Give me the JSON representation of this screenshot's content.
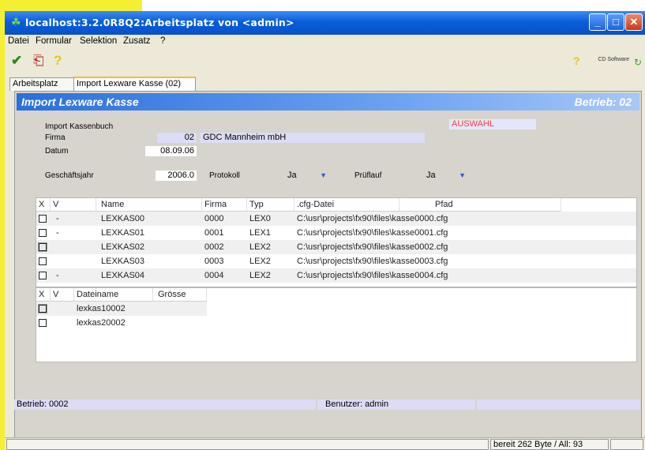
{
  "window": {
    "title": "localhost:3.2.0R8Q2:Arbeitsplatz von <admin>",
    "controls": [
      "minimize",
      "maximize",
      "close"
    ]
  },
  "menu": {
    "items": [
      "Datei",
      "Formular",
      "Selektion",
      "Zusatz",
      "?"
    ]
  },
  "toolbar": {
    "icons": [
      "check-icon",
      "exit-door-icon",
      "help-icon"
    ],
    "brand": "CD Software"
  },
  "tabs": [
    {
      "label": "Arbeitsplatz"
    },
    {
      "label": "Import Lexware Kasse (02)"
    }
  ],
  "form": {
    "header_title": "Import Lexware Kasse",
    "header_betrieb": "Betrieb:   02",
    "section_label": "Import Kassenbuch",
    "firma_label": "Firma",
    "firma_value": "02",
    "firma_name": "GDC Mannheim mbH",
    "datum_label": "Datum",
    "datum_value": "08.09.06",
    "auswahl": "AUSWAHL",
    "geschaeftsjahr_label": "Geschäftsjahr",
    "geschaeftsjahr_value": "2006.0",
    "protokoll_label": "Protokoll",
    "protokoll_value": "Ja",
    "pruflauf_label": "Prüflauf",
    "pruflauf_value": "Ja"
  },
  "kasse_table": {
    "columns": [
      "X",
      "V",
      "Name",
      "Firma",
      "Typ",
      ".cfg-Datei",
      "Pfad"
    ],
    "rows": [
      {
        "v": "-",
        "name": "LEXKAS00",
        "firma": "0000",
        "typ": "LEX0",
        "cfg": "C:\\usr\\projects\\fx90\\files\\kasse0000.cfg"
      },
      {
        "v": "-",
        "name": "LEXKAS01",
        "firma": "0001",
        "typ": "LEX1",
        "cfg": "C:\\usr\\projects\\fx90\\files\\kasse0001.cfg"
      },
      {
        "v": "",
        "name": "LEXKAS02",
        "firma": "0002",
        "typ": "LEX2",
        "cfg": "C:\\usr\\projects\\fx90\\files\\kasse0002.cfg"
      },
      {
        "v": "",
        "name": "LEXKAS03",
        "firma": "0003",
        "typ": "LEX2",
        "cfg": "C:\\usr\\projects\\fx90\\files\\kasse0003.cfg"
      },
      {
        "v": "-",
        "name": "LEXKAS04",
        "firma": "0004",
        "typ": "LEX2",
        "cfg": "C:\\usr\\projects\\fx90\\files\\kasse0004.cfg"
      }
    ]
  },
  "file_table": {
    "columns": [
      "X",
      "V",
      "Dateiname",
      "Grösse"
    ],
    "rows": [
      {
        "name": "lexkas10002",
        "size": ""
      },
      {
        "name": "lexkas20002",
        "size": ""
      }
    ]
  },
  "status": {
    "betrieb": "Betrieb: 0002",
    "benutzer": "Benutzer: admin",
    "bottom": "bereit 262 Byte / All: 93"
  },
  "colors": {
    "title_blue": "#0a5ed8",
    "header_blue": "#2a6fdb",
    "auswahl_red": "#ff3c3c",
    "field_lavender": "#dcdcf6",
    "yellow_bg": "#f4f031"
  }
}
